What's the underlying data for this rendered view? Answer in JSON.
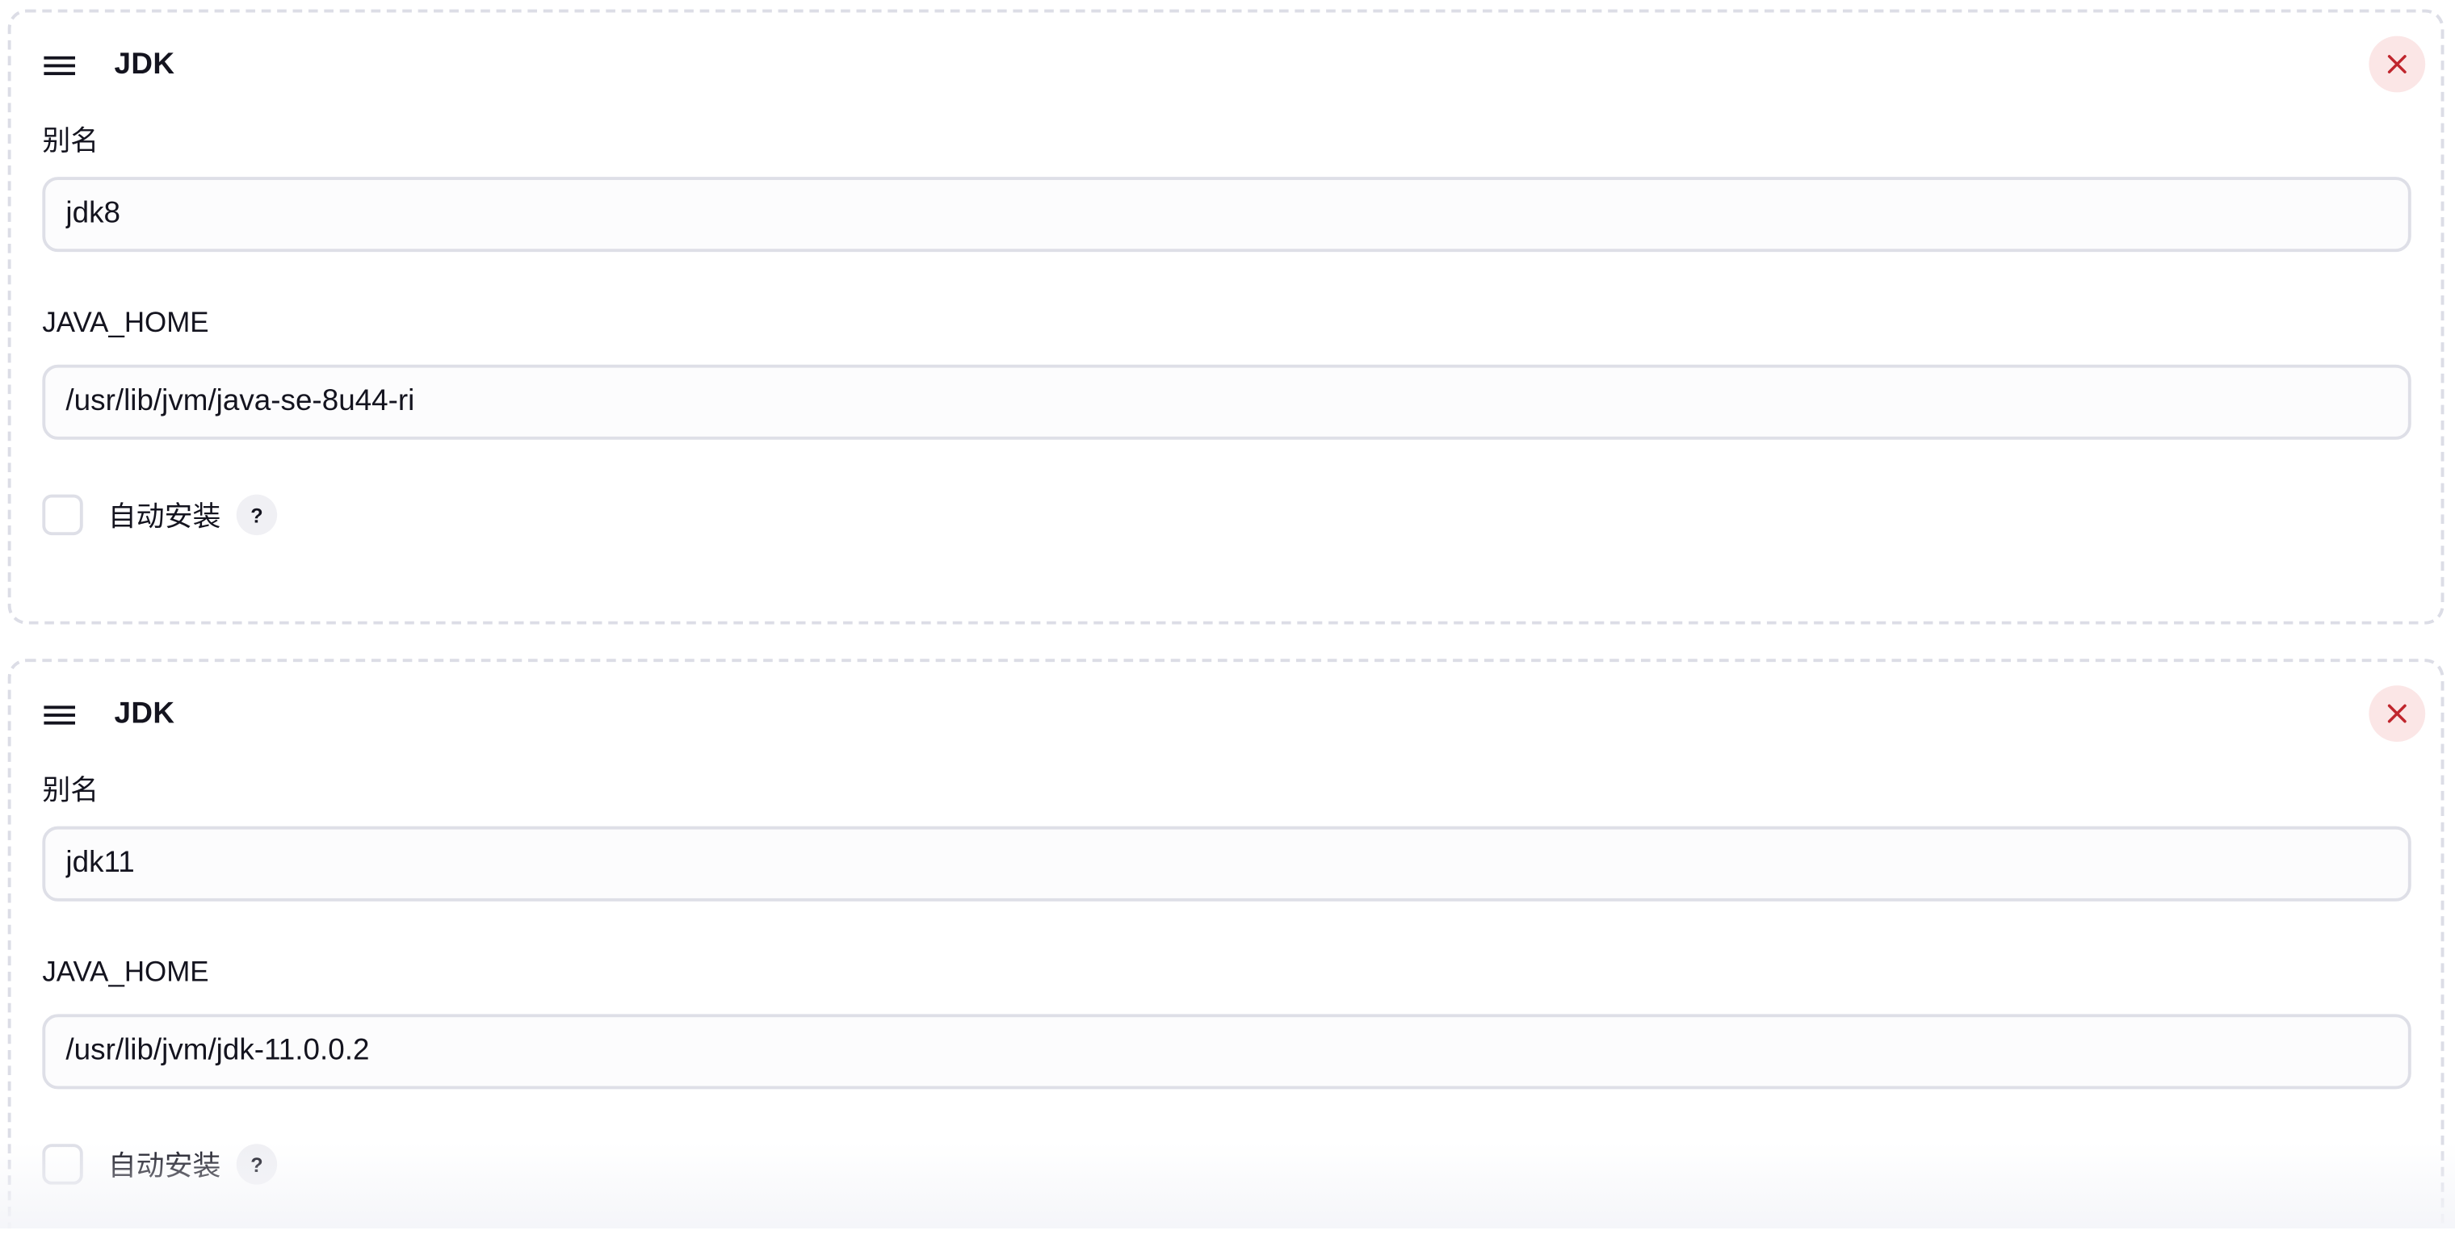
{
  "jdk_installations": [
    {
      "title": "JDK",
      "alias_label": "别名",
      "alias_value": "jdk8",
      "java_home_label": "JAVA_HOME",
      "java_home_value": "/usr/lib/jvm/java-se-8u44-ri",
      "auto_install_label": "自动安装",
      "auto_install_checked": false,
      "help_label": "?",
      "drag_icon": "drag-handle-icon",
      "close_icon": "close-icon"
    },
    {
      "title": "JDK",
      "alias_label": "别名",
      "alias_value": "jdk11",
      "java_home_label": "JAVA_HOME",
      "java_home_value": "/usr/lib/jvm/jdk-11.0.0.2",
      "auto_install_label": "自动安装",
      "auto_install_checked": false,
      "help_label": "?",
      "drag_icon": "drag-handle-icon",
      "close_icon": "close-icon"
    }
  ],
  "colors": {
    "close_bg": "#fbe6e6",
    "close_fg": "#c0262d",
    "border": "#dedfe7",
    "text": "#14141f"
  }
}
